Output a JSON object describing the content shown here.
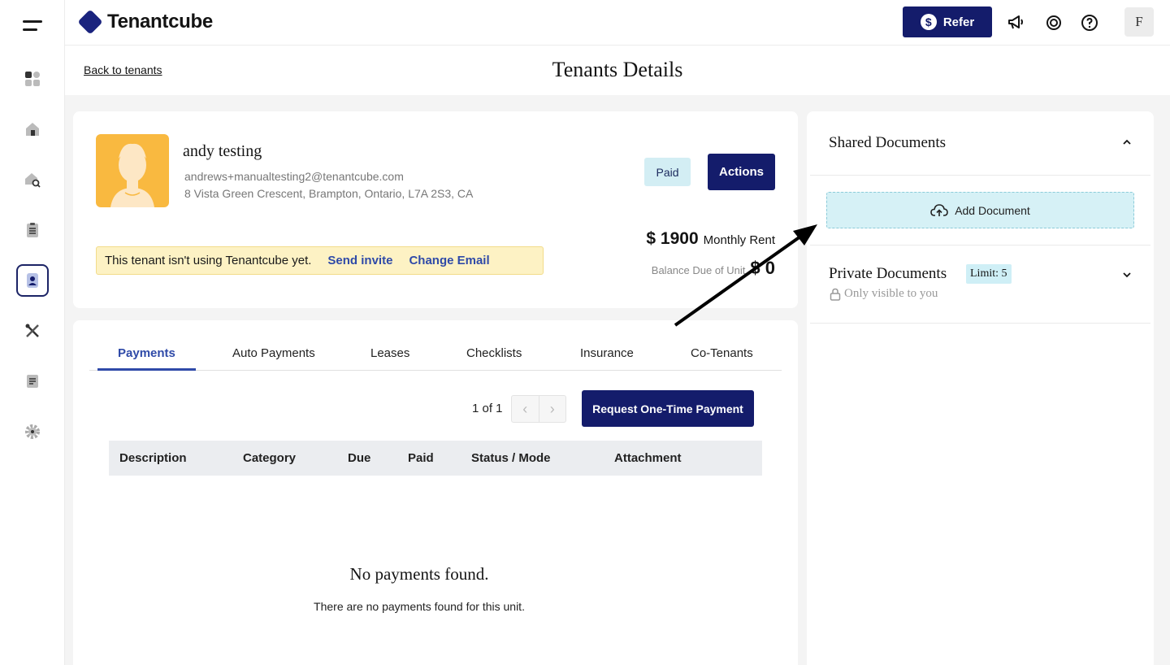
{
  "app": {
    "brand": "Tenantcube"
  },
  "topbar": {
    "refer_label": "Refer",
    "refer_icon": "$",
    "avatar_initial": "F"
  },
  "page": {
    "back_label": "Back to tenants",
    "title": "Tenants Details"
  },
  "tenant": {
    "name": "andy testing",
    "email": "andrews+manualtesting2@tenantcube.com",
    "address": "8 Vista Green Crescent, Brampton, Ontario, L7A 2S3, CA",
    "status_badge": "Paid",
    "actions_label": "Actions",
    "rent_amount": "$ 1900",
    "rent_label": "Monthly Rent",
    "balance_label": "Balance Due of Unit",
    "balance_amount": "$ 0"
  },
  "notice": {
    "text": "This tenant isn't using Tenantcube yet.",
    "invite_label": "Send invite",
    "change_email_label": "Change Email"
  },
  "tabs": [
    "Payments",
    "Auto Payments",
    "Leases",
    "Checklists",
    "Insurance",
    "Co-Tenants"
  ],
  "payments": {
    "pager_text": "1 of 1",
    "request_label": "Request One-Time Payment",
    "columns": [
      "Description",
      "Category",
      "Due",
      "Paid",
      "Status / Mode",
      "Attachment"
    ],
    "empty_title": "No payments found.",
    "empty_sub": "There are no payments found for this unit."
  },
  "documents": {
    "shared_title": "Shared Documents",
    "add_label": "Add Document",
    "private_title": "Private Documents",
    "limit_label": "Limit: 5",
    "private_note": "Only visible to you"
  },
  "colors": {
    "primary": "#141c6b",
    "link": "#2f4aa8",
    "badge": "#d3eef4",
    "notice": "#fdf2c4"
  }
}
